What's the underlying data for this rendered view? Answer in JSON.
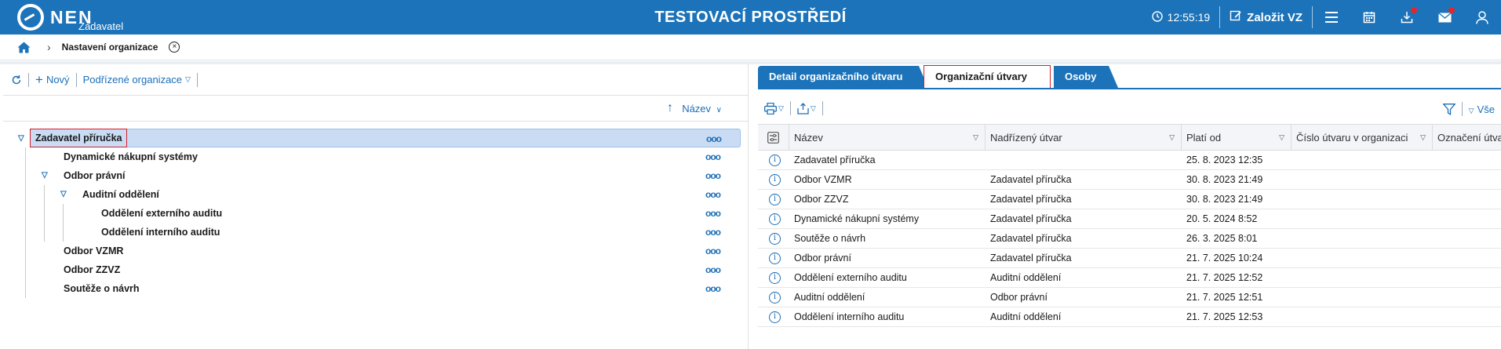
{
  "header": {
    "logo_text": "NEN",
    "logo_sub": "Zadavatel",
    "env_title": "TESTOVACÍ PROSTŘEDÍ",
    "clock": "12:55:19",
    "create_label": "Založit VZ",
    "icons": [
      "clock-icon",
      "edit-icon",
      "menu-icon",
      "calendar-icon",
      "download-icon",
      "mail-icon",
      "user-icon"
    ],
    "accent_color": "#1c73b9",
    "badge_color": "#e3262c"
  },
  "breadcrumb": {
    "label": "Nastavení organizace"
  },
  "left": {
    "toolbar": {
      "new_label": "Nový",
      "subordinate_label": "Podřízené organizace"
    },
    "sort_label": "Název",
    "tree": [
      {
        "label": "Zadavatel příručka",
        "level": 0,
        "expanded": true,
        "selected": true
      },
      {
        "label": "Dynamické nákupní systémy",
        "level": 1,
        "expanded": false
      },
      {
        "label": "Odbor právní",
        "level": 1,
        "expanded": true
      },
      {
        "label": "Auditní oddělení",
        "level": 2,
        "expanded": true
      },
      {
        "label": "Oddělení externího auditu",
        "level": 3,
        "expanded": false
      },
      {
        "label": "Oddělení interního auditu",
        "level": 3,
        "expanded": false
      },
      {
        "label": "Odbor VZMR",
        "level": 1,
        "expanded": false
      },
      {
        "label": "Odbor ZZVZ",
        "level": 1,
        "expanded": false
      },
      {
        "label": "Soutěže o návrh",
        "level": 1,
        "expanded": false
      }
    ]
  },
  "right": {
    "tabs": [
      {
        "label": "Detail organizačního útvaru",
        "active": false
      },
      {
        "label": "Organizační útvary",
        "active": true
      },
      {
        "label": "Osoby",
        "active": false
      }
    ],
    "filter_label": "Vše",
    "columns": [
      "Název",
      "Nadřízený útvar",
      "Platí od",
      "Číslo útvaru v organizaci",
      "Označení útvaru"
    ],
    "rows": [
      [
        "Zadavatel příručka",
        "",
        "25. 8. 2023 12:35"
      ],
      [
        "Odbor VZMR",
        "Zadavatel příručka",
        "30. 8. 2023 21:49"
      ],
      [
        "Odbor ZZVZ",
        "Zadavatel příručka",
        "30. 8. 2023 21:49"
      ],
      [
        "Dynamické nákupní systémy",
        "Zadavatel příručka",
        "20. 5. 2024 8:52"
      ],
      [
        "Soutěže o návrh",
        "Zadavatel příručka",
        "26. 3. 2025 8:01"
      ],
      [
        "Odbor právní",
        "Zadavatel příručka",
        "21. 7. 2025 10:24"
      ],
      [
        "Oddělení externího auditu",
        "Auditní oddělení",
        "21. 7. 2025 12:52"
      ],
      [
        "Auditní oddělení",
        "Odbor právní",
        "21. 7. 2025 12:51"
      ],
      [
        "Oddělení interního auditu",
        "Auditní oddělení",
        "21. 7. 2025 12:53"
      ]
    ]
  }
}
